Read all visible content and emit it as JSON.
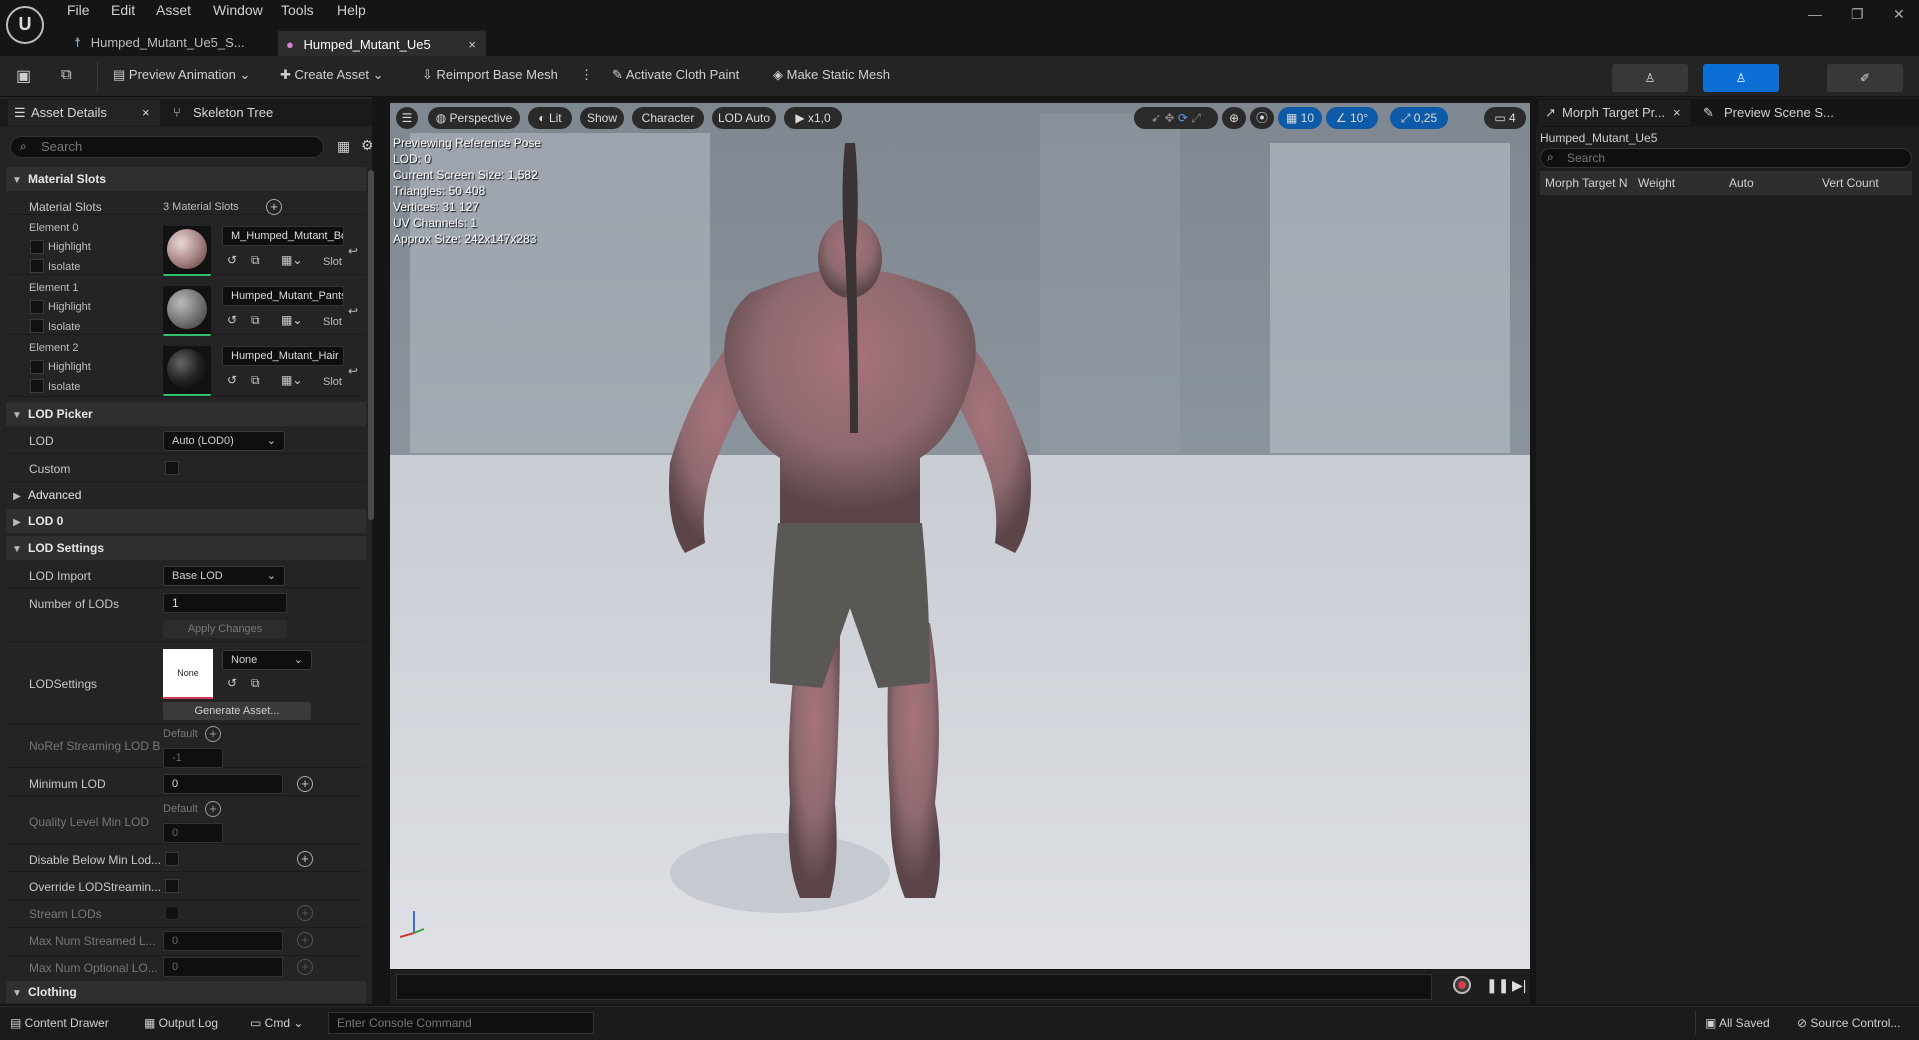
{
  "menu": [
    "File",
    "Edit",
    "Asset",
    "Window",
    "Tools",
    "Help"
  ],
  "tabs": [
    {
      "label": "Humped_Mutant_Ue5_S...",
      "active": false
    },
    {
      "label": "Humped_Mutant_Ue5",
      "active": true
    }
  ],
  "toolbar": {
    "preview_animation": "Preview Animation",
    "create_asset": "Create Asset",
    "reimport": "Reimport Base Mesh",
    "cloth_paint": "Activate Cloth Paint",
    "static_mesh": "Make Static Mesh"
  },
  "left_panel": {
    "tab_details": "Asset Details",
    "tab_skeleton": "Skeleton Tree",
    "search_placeholder": "Search",
    "sections": {
      "material_slots": "Material Slots",
      "lod_picker": "LOD Picker",
      "advanced": "Advanced",
      "lod0": "LOD 0",
      "lod_settings": "LOD Settings",
      "clothing": "Clothing"
    },
    "material_slots_label": "Material Slots",
    "material_slots_count": "3 Material Slots",
    "elements": [
      {
        "label": "Element 0",
        "material": "M_Humped_Mutant_Bo",
        "highlight": "Highlight",
        "isolate": "Isolate",
        "slot": "Slot"
      },
      {
        "label": "Element 1",
        "material": "Humped_Mutant_Pants",
        "highlight": "Highlight",
        "isolate": "Isolate",
        "slot": "Slot"
      },
      {
        "label": "Element 2",
        "material": "Humped_Mutant_Hair",
        "highlight": "Highlight",
        "isolate": "Isolate",
        "slot": "Slot"
      }
    ],
    "lod_label": "LOD",
    "lod_value": "Auto (LOD0)",
    "custom_label": "Custom",
    "lod_import_label": "LOD Import",
    "lod_import_value": "Base LOD",
    "num_lods_label": "Number of LODs",
    "num_lods_value": "1",
    "apply_changes": "Apply Changes",
    "lodsettings_label": "LODSettings",
    "lodsettings_thumb": "None",
    "lodsettings_value": "None",
    "generate_asset": "Generate Asset...",
    "noref_label": "NoRef Streaming LOD B",
    "noref_default": "Default",
    "noref_value": "-1",
    "min_lod_label": "Minimum LOD",
    "min_lod_value": "0",
    "quality_label": "Quality Level Min LOD",
    "quality_default": "Default",
    "quality_value": "0",
    "disable_below_label": "Disable Below Min Lod...",
    "override_label": "Override LODStreamin...",
    "stream_lods_label": "Stream LODs",
    "max_streamed_label": "Max Num Streamed L...",
    "max_streamed_value": "0",
    "max_optional_label": "Max Num Optional LO...",
    "max_optional_value": "0"
  },
  "viewport": {
    "perspective": "Perspective",
    "lit": "Lit",
    "show": "Show",
    "character": "Character",
    "lod_auto": "LOD Auto",
    "speed": "x1,0",
    "grid": "10",
    "angle": "10°",
    "scale": "0,25",
    "camera": "4",
    "info": [
      "Previewing Reference Pose",
      "LOD: 0",
      "Current Screen Size: 1,582",
      "Triangles: 50 408",
      "Vertices: 31 127",
      "UV Channels: 1",
      "Approx Size: 242x147x283"
    ]
  },
  "right_panel": {
    "tab_morph": "Morph Target Pr...",
    "tab_scene": "Preview Scene S...",
    "asset_name": "Humped_Mutant_Ue5",
    "search_placeholder": "Search",
    "columns": [
      "Morph Target N",
      "Weight",
      "Auto",
      "Vert Count"
    ]
  },
  "statusbar": {
    "content_drawer": "Content Drawer",
    "output_log": "Output Log",
    "cmd": "Cmd",
    "console_placeholder": "Enter Console Command",
    "all_saved": "All Saved",
    "source_control": "Source Control..."
  }
}
